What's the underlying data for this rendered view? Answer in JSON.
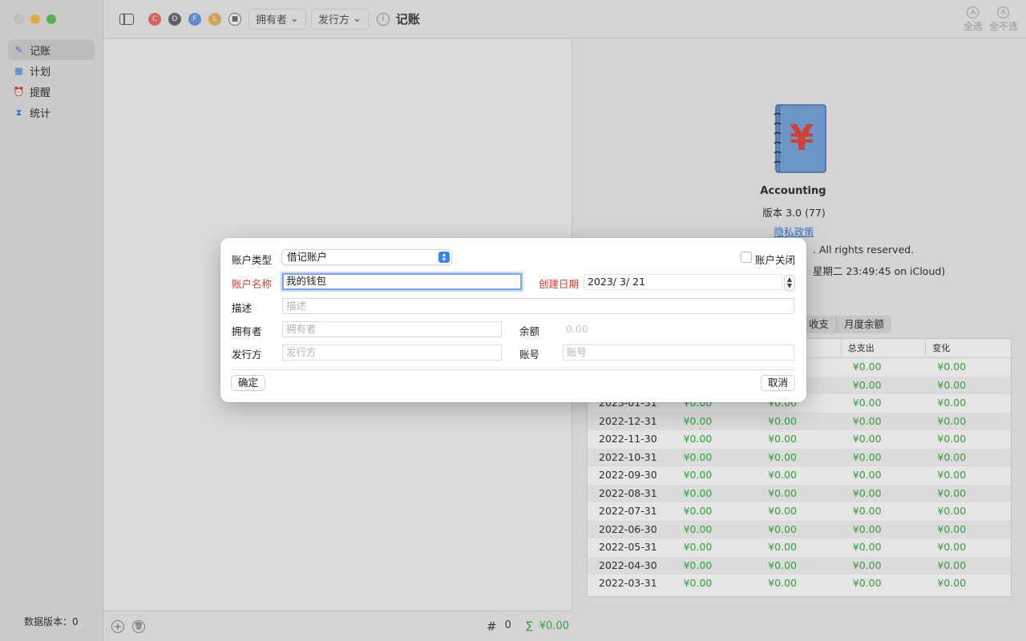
{
  "sidebar": {
    "items": [
      {
        "label": "记账",
        "icon": "pencil-square-icon"
      },
      {
        "label": "计划",
        "icon": "calendar-icon"
      },
      {
        "label": "提醒",
        "icon": "alarm-clock-icon"
      },
      {
        "label": "统计",
        "icon": "hourglass-icon"
      }
    ],
    "footer": "数据版本：0"
  },
  "toolbar": {
    "tags": [
      {
        "letter": "C",
        "color": "#e8726b"
      },
      {
        "letter": "D",
        "color": "#6e6e6e"
      },
      {
        "letter": "F",
        "color": "#6f9ae8"
      },
      {
        "letter": "L",
        "color": "#e8b860"
      }
    ],
    "owner_filter": "拥有者",
    "issuer_filter": "发行方",
    "title": "记账",
    "select_all": "全选",
    "select_none": "全不选"
  },
  "list_footer": {
    "count_symbol": "#",
    "count": "0",
    "sum_symbol": "∑",
    "sum": "¥0.00"
  },
  "about": {
    "name": "Accounting",
    "version": "版本 3.0 (77)",
    "privacy": "隐私政策",
    "copyright": ". All rights reserved.",
    "sync": "星期二 23:49:45 on iCloud)"
  },
  "segments": [
    "收支",
    "月度余额"
  ],
  "table": {
    "headers": [
      "",
      "",
      "",
      "总支出",
      "变化"
    ],
    "rows": [
      [
        "",
        "",
        "",
        "¥0.00",
        "¥0.00"
      ],
      [
        "",
        "",
        "",
        "¥0.00",
        "¥0.00"
      ],
      [
        "2023-01-31",
        "¥0.00",
        "¥0.00",
        "¥0.00",
        "¥0.00"
      ],
      [
        "2022-12-31",
        "¥0.00",
        "¥0.00",
        "¥0.00",
        "¥0.00"
      ],
      [
        "2022-11-30",
        "¥0.00",
        "¥0.00",
        "¥0.00",
        "¥0.00"
      ],
      [
        "2022-10-31",
        "¥0.00",
        "¥0.00",
        "¥0.00",
        "¥0.00"
      ],
      [
        "2022-09-30",
        "¥0.00",
        "¥0.00",
        "¥0.00",
        "¥0.00"
      ],
      [
        "2022-08-31",
        "¥0.00",
        "¥0.00",
        "¥0.00",
        "¥0.00"
      ],
      [
        "2022-07-31",
        "¥0.00",
        "¥0.00",
        "¥0.00",
        "¥0.00"
      ],
      [
        "2022-06-30",
        "¥0.00",
        "¥0.00",
        "¥0.00",
        "¥0.00"
      ],
      [
        "2022-05-31",
        "¥0.00",
        "¥0.00",
        "¥0.00",
        "¥0.00"
      ],
      [
        "2022-04-30",
        "¥0.00",
        "¥0.00",
        "¥0.00",
        "¥0.00"
      ],
      [
        "2022-03-31",
        "¥0.00",
        "¥0.00",
        "¥0.00",
        "¥0.00"
      ]
    ]
  },
  "dialog": {
    "account_type_label": "账户类型",
    "account_type_value": "借记账户",
    "account_closed_label": "账户关闭",
    "account_name_label": "账户名称",
    "account_name_value": "我的钱包",
    "created_date_label": "创建日期",
    "created_date_value": "2023/  3/ 21",
    "description_label": "描述",
    "description_placeholder": "描述",
    "owner_label": "拥有者",
    "owner_placeholder": "拥有者",
    "balance_label": "余额",
    "balance_placeholder": "0.00",
    "issuer_label": "发行方",
    "issuer_placeholder": "发行方",
    "account_number_label": "账号",
    "account_number_placeholder": "账号",
    "confirm": "确定",
    "cancel": "取消"
  }
}
